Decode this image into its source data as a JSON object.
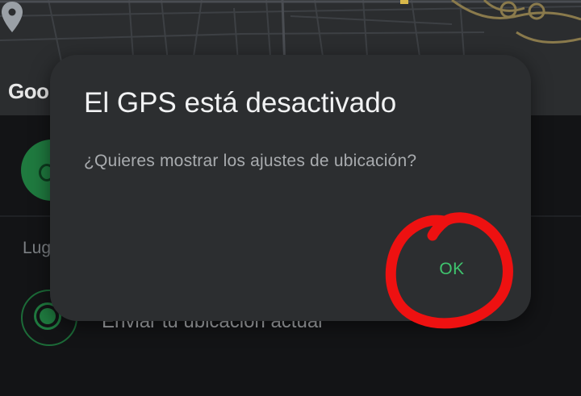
{
  "map": {
    "attribution": "Goo",
    "icons": {
      "pin": "map-pin-icon"
    }
  },
  "sheet": {
    "section_label": "Lug",
    "send_location_label": "Enviar tu ubicación actual",
    "icons": {
      "share_live": "live-location-icon",
      "send_location": "target-location-icon"
    }
  },
  "dialog": {
    "title": "El GPS está desactivado",
    "message": "¿Quieres mostrar los ajustes de ubicación?",
    "ok_label": "OK"
  },
  "colors": {
    "accent": "#3fc46e",
    "dialog_bg": "#2c2e30",
    "annotation": "#ee1111"
  }
}
